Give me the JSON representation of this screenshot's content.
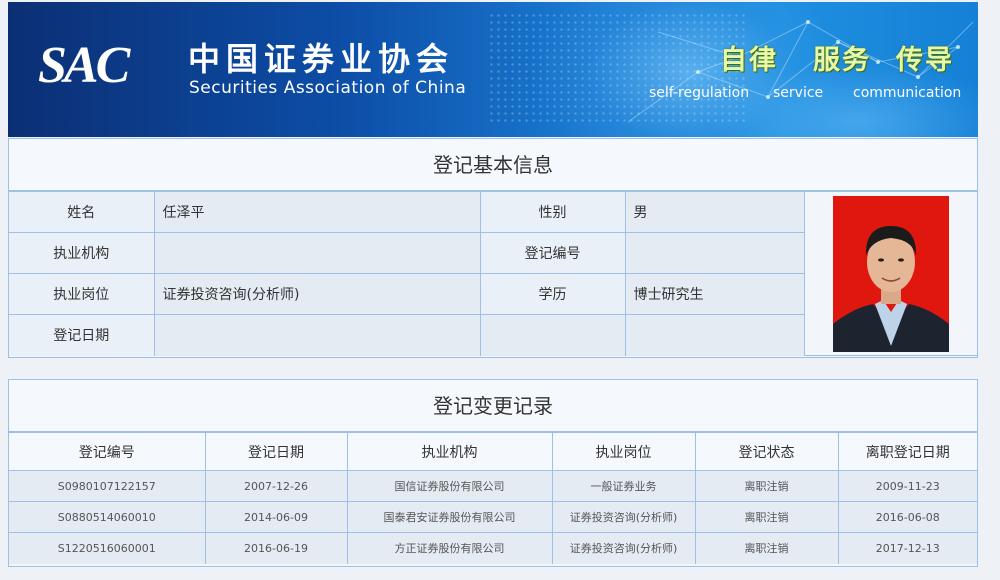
{
  "header": {
    "logo_abbr": "SAC",
    "logo_cn": "中国证券业协会",
    "logo_en": "Securities Association of China",
    "slogans": [
      {
        "cn": "自律",
        "en": "self-regulation"
      },
      {
        "cn": "服务",
        "en": "service"
      },
      {
        "cn": "传导",
        "en": "communication"
      }
    ]
  },
  "basic_info": {
    "title": "登记基本信息",
    "fields": {
      "name_label": "姓名",
      "name": "任泽平",
      "gender_label": "性别",
      "gender": "男",
      "institution_label": "执业机构",
      "institution": "",
      "reg_no_label": "登记编号",
      "reg_no": "",
      "position_label": "执业岗位",
      "position": "证券投资咨询(分析师)",
      "education_label": "学历",
      "education": "博士研究生",
      "reg_date_label": "登记日期",
      "reg_date": ""
    }
  },
  "change_records": {
    "title": "登记变更记录",
    "columns": [
      "登记编号",
      "登记日期",
      "执业机构",
      "执业岗位",
      "登记状态",
      "离职登记日期"
    ],
    "rows": [
      [
        "S0980107122157",
        "2007-12-26",
        "国信证券股份有限公司",
        "一般证券业务",
        "离职注销",
        "2009-11-23"
      ],
      [
        "S0880514060010",
        "2014-06-09",
        "国泰君安证券股份有限公司",
        "证券投资咨询(分析师)",
        "离职注销",
        "2016-06-08"
      ],
      [
        "S1220516060001",
        "2016-06-19",
        "方正证券股份有限公司",
        "证券投资咨询(分析师)",
        "离职注销",
        "2017-12-13"
      ]
    ]
  },
  "colors": {
    "banner_dark": "#0b2f74",
    "banner_light": "#1f8fe0",
    "border": "#9cc0e6",
    "photo_bg": "#e0170f",
    "slogan": "#e9f7a8"
  }
}
